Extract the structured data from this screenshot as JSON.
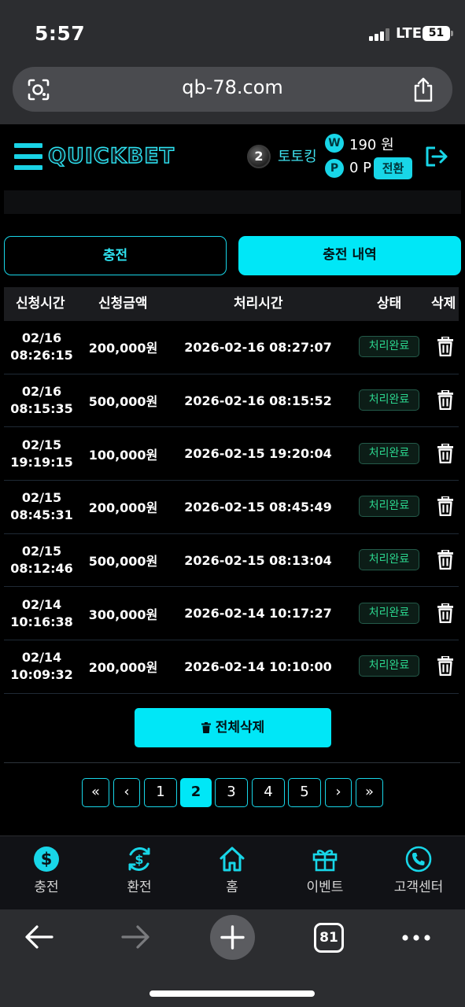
{
  "status_bar": {
    "time": "5:57",
    "network": "LTE",
    "battery": "51"
  },
  "browser": {
    "url": "qb-78.com",
    "tab_count": "81"
  },
  "header": {
    "logo": "QUICKBET",
    "level": "2",
    "username": "토토킹",
    "money_icon": "W",
    "money": "190 원",
    "points_icon": "P",
    "points": "0 P",
    "convert_label": "전환"
  },
  "tabs": {
    "charge": "충전",
    "history": "충전 내역"
  },
  "table": {
    "headers": [
      "신청시간",
      "신청금액",
      "처리시간",
      "상태",
      "삭제"
    ],
    "rows": [
      {
        "req_date": "02/16",
        "req_time": "08:26:15",
        "amount": "200,000원",
        "processed": "2026-02-16 08:27:07",
        "status": "처리완료"
      },
      {
        "req_date": "02/16",
        "req_time": "08:15:35",
        "amount": "500,000원",
        "processed": "2026-02-16 08:15:52",
        "status": "처리완료"
      },
      {
        "req_date": "02/15",
        "req_time": "19:19:15",
        "amount": "100,000원",
        "processed": "2026-02-15 19:20:04",
        "status": "처리완료"
      },
      {
        "req_date": "02/15",
        "req_time": "08:45:31",
        "amount": "200,000원",
        "processed": "2026-02-15 08:45:49",
        "status": "처리완료"
      },
      {
        "req_date": "02/15",
        "req_time": "08:12:46",
        "amount": "500,000원",
        "processed": "2026-02-15 08:13:04",
        "status": "처리완료"
      },
      {
        "req_date": "02/14",
        "req_time": "10:16:38",
        "amount": "300,000원",
        "processed": "2026-02-14 10:17:27",
        "status": "처리완료"
      },
      {
        "req_date": "02/14",
        "req_time": "10:09:32",
        "amount": "200,000원",
        "processed": "2026-02-14 10:10:00",
        "status": "처리완료"
      }
    ]
  },
  "delete_all_label": "전체삭제",
  "pagination": {
    "first": "«",
    "prev": "‹",
    "pages": [
      "1",
      "2",
      "3",
      "4",
      "5"
    ],
    "current": "2",
    "next": "›",
    "last": "»"
  },
  "bottom_nav": [
    {
      "label": "충전",
      "icon": "dollar-icon"
    },
    {
      "label": "환전",
      "icon": "exchange-icon"
    },
    {
      "label": "홈",
      "icon": "home-icon"
    },
    {
      "label": "이벤트",
      "icon": "gift-icon"
    },
    {
      "label": "고객센터",
      "icon": "phone-icon"
    }
  ],
  "colors": {
    "accent": "#00e7f7",
    "status_green": "#2bd48d",
    "background": "#000000"
  }
}
